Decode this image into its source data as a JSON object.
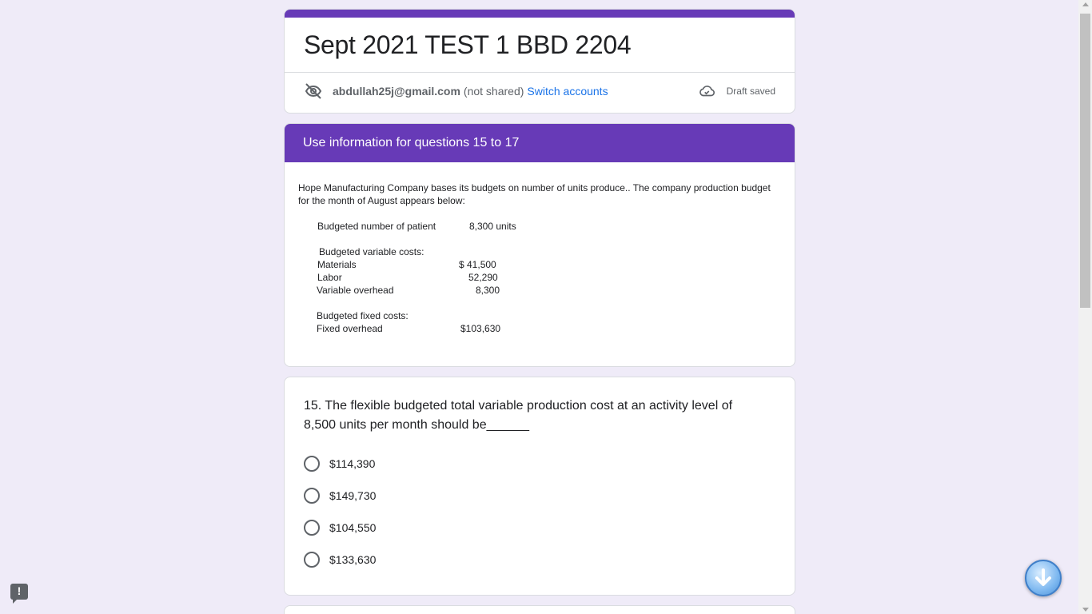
{
  "form": {
    "title": "Sept 2021 TEST 1 BBD 2204",
    "account_email": "abdullah25j@gmail.com",
    "not_shared": "(not shared)",
    "switch_accounts": "Switch accounts",
    "draft_status": "Draft saved"
  },
  "section": {
    "header": "Use information for questions 15 to 17",
    "description": "Hope Manufacturing Company bases its budgets on number of units produce.. The company production budget for the month of August appears below:",
    "budget": {
      "patients_label": "Budgeted number of patient",
      "patients_value": "8,300 units",
      "variable_heading": "Budgeted variable costs:",
      "materials_label": "Materials",
      "materials_value": "$ 41,500",
      "labor_label": "Labor",
      "labor_value": "52,290",
      "var_overhead_label": "Variable overhead",
      "var_overhead_value": "8,300",
      "fixed_heading": "Budgeted fixed costs:",
      "fixed_overhead_label": "Fixed overhead",
      "fixed_overhead_value": "$103,630"
    }
  },
  "question": {
    "text": "15. The flexible budgeted total variable production cost at an activity level of 8,500 units per month should be______",
    "options": [
      "$114,390",
      "$149,730",
      "$104,550",
      "$133,630"
    ]
  },
  "icons": {
    "eye_off": "eye-off-icon",
    "cloud": "cloud-done-icon",
    "feedback": "feedback-icon",
    "scroll_down": "arrow-down-icon"
  },
  "colors": {
    "accent": "#673ab7",
    "background": "#efebf8",
    "link": "#1a73e8"
  }
}
